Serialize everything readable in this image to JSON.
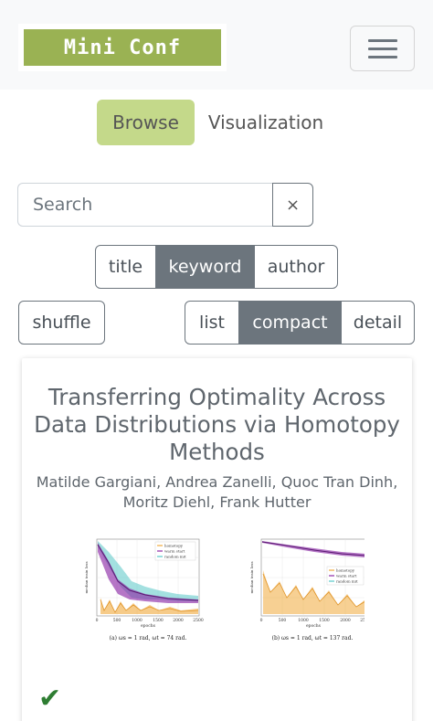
{
  "header": {
    "logo_text": "Mini Conf",
    "menu_icon": "hamburger-menu-icon",
    "brand_color": "#9ab253"
  },
  "nav": {
    "browse": "Browse",
    "visualization": "Visualization",
    "active_color": "#c4d98a"
  },
  "search": {
    "placeholder": "Search",
    "value": "",
    "clear_label": "×"
  },
  "filter": {
    "options": [
      "title",
      "keyword",
      "author"
    ],
    "selected": "keyword"
  },
  "shuffle_label": "shuffle",
  "view": {
    "options": [
      "list",
      "compact",
      "detail"
    ],
    "selected": "compact"
  },
  "paper": {
    "title": "Transferring Optimality Across Data Distributions via Homotopy Methods",
    "authors": "Matilde Gargiani, Andrea Zanelli, Quoc Tran Dinh, Moritz Diehl, Frank Hutter",
    "thumbnail": {
      "left_caption": "(a) ωs = 1 rad, ωt = 74 rad.",
      "right_caption": "(b) ωs = 1 rad, ωt = 137 rad.",
      "legend": [
        "homotopy",
        "warm start",
        "random init"
      ],
      "xlabel": "epochs",
      "ylabel": "median train loss",
      "left_xticks": [
        "0",
        "500",
        "1000",
        "1500",
        "2000",
        "2500"
      ],
      "right_xticks": [
        "0",
        "500",
        "1000",
        "1500",
        "2000",
        "2500"
      ]
    },
    "status_icon": "check-icon",
    "status_glyph": "✔"
  }
}
